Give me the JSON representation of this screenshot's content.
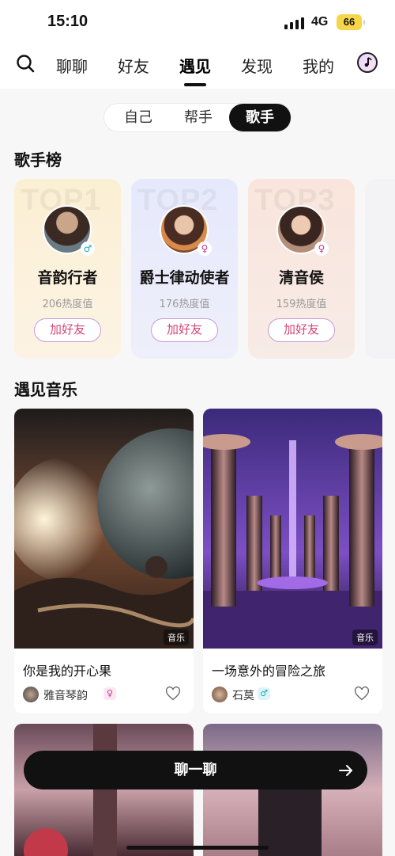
{
  "status": {
    "time": "15:10",
    "network": "4G",
    "battery": "66"
  },
  "nav": {
    "tabs": [
      {
        "label": "聊聊"
      },
      {
        "label": "好友"
      },
      {
        "label": "遇见",
        "active": true
      },
      {
        "label": "发现"
      },
      {
        "label": "我的"
      }
    ]
  },
  "segment": {
    "options": [
      "自己",
      "帮手",
      "歌手"
    ],
    "selected": "歌手"
  },
  "ranking": {
    "title": "歌手榜",
    "cards": [
      {
        "rank": "TOP1",
        "name": "音韵行者",
        "heat": "206热度值",
        "button": "加好友",
        "gender": "♂",
        "theme": "#fbf0d8"
      },
      {
        "rank": "TOP2",
        "name": "爵士律动使者",
        "heat": "176热度值",
        "button": "加好友",
        "gender": "♀",
        "theme": "#eaecfb"
      },
      {
        "rank": "TOP3",
        "name": "清音侯",
        "heat": "159热度值",
        "button": "加好友",
        "gender": "♀",
        "theme": "#fae8df"
      }
    ]
  },
  "music": {
    "title": "遇见音乐",
    "cards": [
      {
        "title": "你是我的开心果",
        "tag": "音乐",
        "user": "雅音琴韵",
        "gender": "♀"
      },
      {
        "title": "一场意外的冒险之旅",
        "tag": "音乐",
        "user": "石莫",
        "gender": "♂"
      }
    ]
  },
  "chat_button": {
    "label": "聊一聊"
  }
}
